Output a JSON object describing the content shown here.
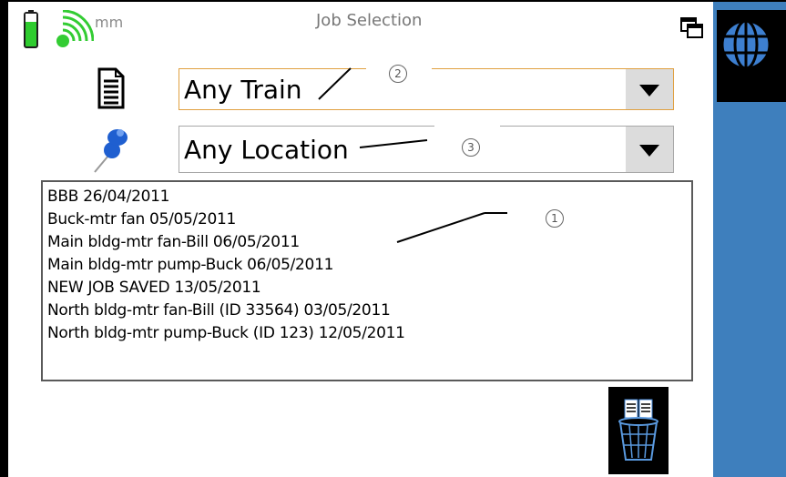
{
  "header": {
    "title": "Job Selection",
    "signal_label": "mm"
  },
  "icons": {
    "battery": "battery-icon",
    "signal": "wifi-signal-icon",
    "window": "window-icon",
    "document": "document-icon",
    "location": "pushpin-icon",
    "globe": "globe-icon",
    "delete": "recycle-bin-icon"
  },
  "filters": {
    "train": {
      "value": "Any Train"
    },
    "location": {
      "value": "Any Location"
    }
  },
  "callouts": {
    "one": "1",
    "two": "2",
    "three": "3"
  },
  "jobs": [
    "BBB 26/04/2011",
    "Buck-mtr fan 05/05/2011",
    "Main bldg-mtr fan-Bill 06/05/2011",
    "Main bldg-mtr pump-Buck 06/05/2011",
    "NEW JOB SAVED 13/05/2011",
    "North bldg-mtr fan-Bill (ID 33564) 03/05/2011",
    "North bldg-mtr pump-Buck (ID 123) 12/05/2011"
  ],
  "colors": {
    "sidebar": "#3e7fbd",
    "battery": "#2ecc2e",
    "signal": "#33cc33",
    "pin": "#1f5fd0",
    "globe": "#3d7fd0",
    "train_border": "#e0a040"
  }
}
